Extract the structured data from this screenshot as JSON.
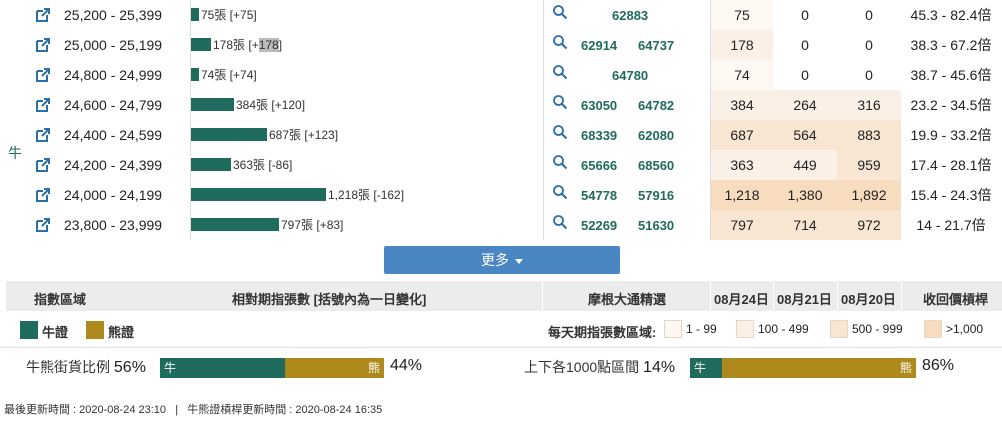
{
  "side_label": "牛",
  "rows": [
    {
      "range": "25,200 - 25,399",
      "bar_value": 75,
      "bar_text_pre": "75張 [+75]",
      "bar_text_hl": "",
      "bar_text_post": "",
      "codes": [
        "62883"
      ],
      "d1": "75",
      "d2": "0",
      "d3": "0",
      "d1_level": 1,
      "d2_level": 0,
      "d3_level": 0,
      "multiple": "45.3 - 82.4倍"
    },
    {
      "range": "25,000 - 25,199",
      "bar_value": 178,
      "bar_text_pre": "178張 [+",
      "bar_text_hl": "178",
      "bar_text_post": "]",
      "codes": [
        "62914",
        "64737"
      ],
      "d1": "178",
      "d2": "0",
      "d3": "0",
      "d1_level": 2,
      "d2_level": 0,
      "d3_level": 0,
      "multiple": "38.3 - 67.2倍"
    },
    {
      "range": "24,800 - 24,999",
      "bar_value": 74,
      "bar_text_pre": "74張 [+74]",
      "bar_text_hl": "",
      "bar_text_post": "",
      "codes": [
        "64780"
      ],
      "d1": "74",
      "d2": "0",
      "d3": "0",
      "d1_level": 1,
      "d2_level": 0,
      "d3_level": 0,
      "multiple": "38.7 - 45.6倍"
    },
    {
      "range": "24,600 - 24,799",
      "bar_value": 384,
      "bar_text_pre": "384張 [+120]",
      "bar_text_hl": "",
      "bar_text_post": "",
      "codes": [
        "63050",
        "64782"
      ],
      "d1": "384",
      "d2": "264",
      "d3": "316",
      "d1_level": 2,
      "d2_level": 2,
      "d3_level": 2,
      "multiple": "23.2 - 34.5倍"
    },
    {
      "range": "24,400 - 24,599",
      "bar_value": 687,
      "bar_text_pre": "687張 [+123]",
      "bar_text_hl": "",
      "bar_text_post": "",
      "codes": [
        "68339",
        "62080"
      ],
      "d1": "687",
      "d2": "564",
      "d3": "883",
      "d1_level": 3,
      "d2_level": 3,
      "d3_level": 3,
      "multiple": "19.9 - 33.2倍"
    },
    {
      "range": "24,200 - 24,399",
      "bar_value": 363,
      "bar_text_pre": "363張 [-86]",
      "bar_text_hl": "",
      "bar_text_post": "",
      "codes": [
        "65666",
        "68560"
      ],
      "d1": "363",
      "d2": "449",
      "d3": "959",
      "d1_level": 2,
      "d2_level": 2,
      "d3_level": 3,
      "multiple": "17.4 - 28.1倍"
    },
    {
      "range": "24,000 - 24,199",
      "bar_value": 1218,
      "bar_text_pre": "1,218張 [-162]",
      "bar_text_hl": "",
      "bar_text_post": "",
      "codes": [
        "54778",
        "57916"
      ],
      "d1": "1,218",
      "d2": "1,380",
      "d3": "1,892",
      "d1_level": 4,
      "d2_level": 4,
      "d3_level": 4,
      "multiple": "15.4 - 24.3倍"
    },
    {
      "range": "23,800 - 23,999",
      "bar_value": 797,
      "bar_text_pre": "797張 [+83]",
      "bar_text_hl": "",
      "bar_text_post": "",
      "codes": [
        "52269",
        "51630"
      ],
      "d1": "797",
      "d2": "714",
      "d3": "972",
      "d1_level": 3,
      "d2_level": 3,
      "d3_level": 3,
      "multiple": "14 - 21.7倍"
    }
  ],
  "more_button": "更多",
  "header": {
    "zone": "指數區域",
    "relative": "相對期指張數 [括號內為一日變化]",
    "morgan": "摩根大通精選",
    "d1": "08月24日",
    "d2": "08月21日",
    "d3": "08月20日",
    "multiple": "收回價槓桿"
  },
  "legend": {
    "bull": "牛證",
    "bear": "熊證",
    "daily_label": "每天期指張數區域:",
    "levels": [
      "1 - 99",
      "100 - 499",
      "500 - 999",
      ">1,000"
    ]
  },
  "ratios": {
    "street_label": "牛熊街貨比例",
    "street_bull_pct": "56%",
    "street_bear_pct": "44%",
    "street_bull_fraction": 0.56,
    "range_label": "上下各1000點區間",
    "range_bull_pct": "14%",
    "range_bear_pct": "86%",
    "range_bull_fraction": 0.14,
    "bull_short": "牛",
    "bear_short": "熊"
  },
  "footer": {
    "last_update_label": "最後更新時間 : 2020-08-24 23:10",
    "separator": "|",
    "index_update_label": "牛熊證槓桿更新時間 : 2020-08-24 16:35"
  },
  "colors": {
    "bull": "#1f6b5d",
    "bear": "#ae8a1e",
    "button": "#4a86c4",
    "level1": "#fdf8f2",
    "level2": "#fbf0e6",
    "level3": "#f9e6d2",
    "level4": "#f7dcc0"
  },
  "icons": {
    "row_link": "external-link-icon",
    "row_search": "magnifier-icon",
    "more_caret": "caret-down-icon"
  }
}
